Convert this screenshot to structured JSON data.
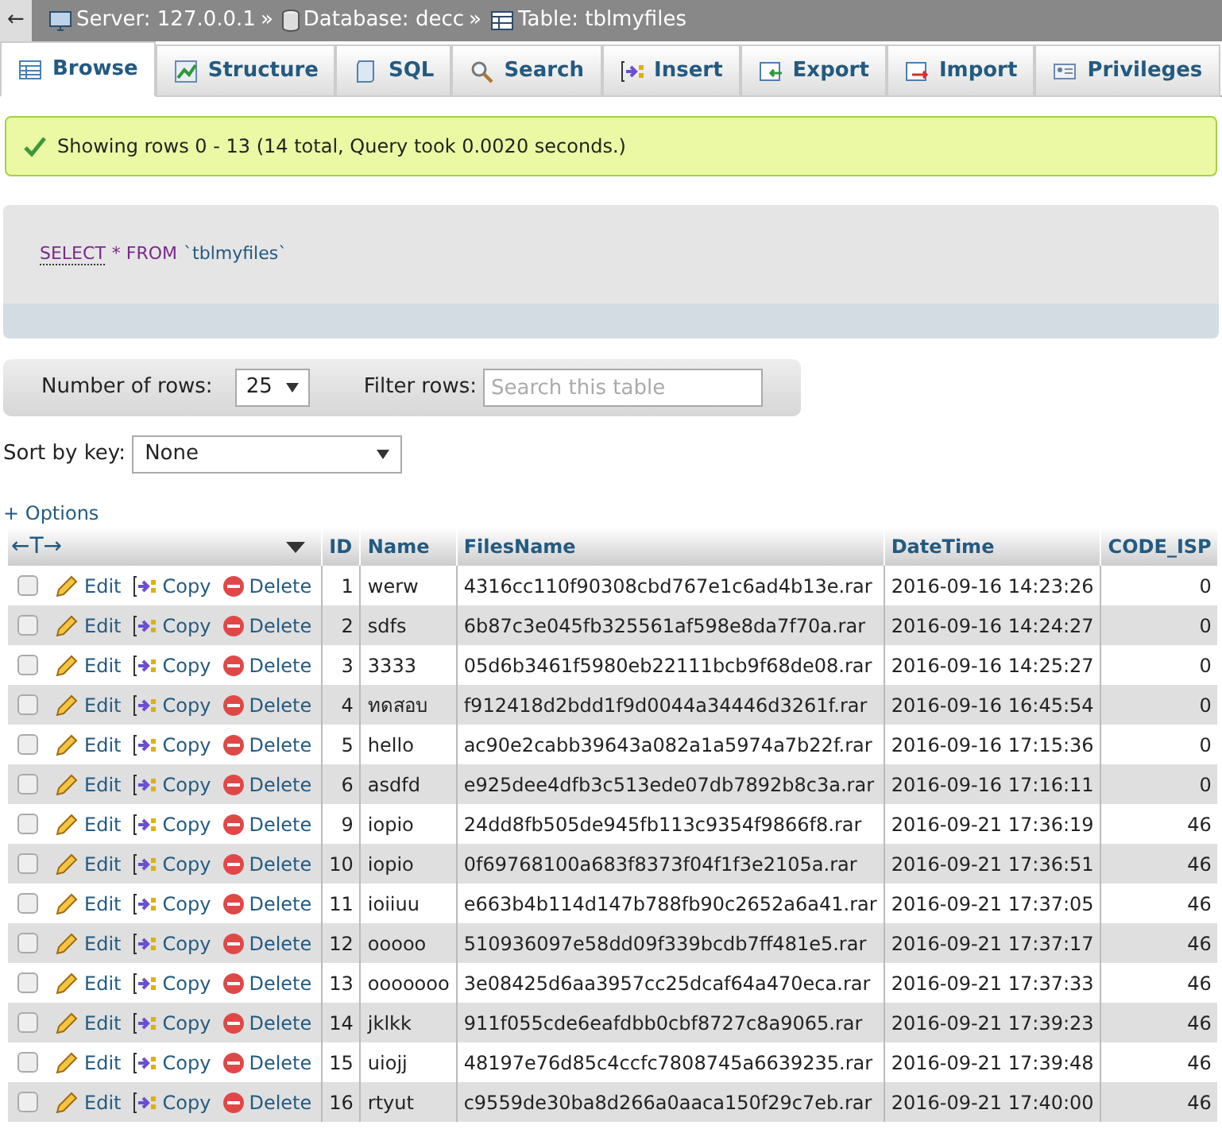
{
  "breadcrumb": {
    "back": "←",
    "items": [
      {
        "kind": "server",
        "text": "Server: 127.0.0.1"
      },
      {
        "kind": "database",
        "text": "Database: decc"
      },
      {
        "kind": "table",
        "text": "Table: tblmyfiles"
      }
    ],
    "separator": "»"
  },
  "tabs": [
    {
      "label": "Browse",
      "selected": true
    },
    {
      "label": "Structure",
      "selected": false
    },
    {
      "label": "SQL",
      "selected": false
    },
    {
      "label": "Search",
      "selected": false
    },
    {
      "label": "Insert",
      "selected": false
    },
    {
      "label": "Export",
      "selected": false
    },
    {
      "label": "Import",
      "selected": false
    },
    {
      "label": "Privileges",
      "selected": false
    }
  ],
  "message": "Showing rows 0 - 13 (14 total, Query took 0.0020 seconds.)",
  "query": {
    "keyword": "SELECT",
    "rest": "* FROM",
    "table": "`tblmyfiles`"
  },
  "navigation": {
    "rows_label": "Number of rows:",
    "rows_value": "25",
    "filter_label": "Filter rows:",
    "filter_placeholder": "Search this table"
  },
  "sort": {
    "label": "Sort by key:",
    "value": "None"
  },
  "options": "+ Options",
  "table": {
    "arrows": "←T→",
    "columns": [
      "ID",
      "Name",
      "FilesName",
      "DateTime",
      "CODE_ISP"
    ],
    "rows": [
      {
        "checked": false,
        "actions": [
          "Edit",
          "Copy",
          "Delete"
        ],
        "cells": [
          "1",
          "werw",
          "4316cc110f90308cbd767e1c6ad4b13e.rar",
          "2016-09-16 14:23:26",
          "0"
        ]
      },
      {
        "checked": false,
        "actions": [
          "Edit",
          "Copy",
          "Delete"
        ],
        "cells": [
          "2",
          "sdfs",
          "6b87c3e045fb325561af598e8da7f70a.rar",
          "2016-09-16 14:24:27",
          "0"
        ]
      },
      {
        "checked": false,
        "actions": [
          "Edit",
          "Copy",
          "Delete"
        ],
        "cells": [
          "3",
          "3333",
          "05d6b3461f5980eb22111bcb9f68de08.rar",
          "2016-09-16 14:25:27",
          "0"
        ]
      },
      {
        "checked": false,
        "actions": [
          "Edit",
          "Copy",
          "Delete"
        ],
        "cells": [
          "4",
          "ทดสอบ",
          "f912418d2bdd1f9d0044a34446d3261f.rar",
          "2016-09-16 16:45:54",
          "0"
        ]
      },
      {
        "checked": false,
        "actions": [
          "Edit",
          "Copy",
          "Delete"
        ],
        "cells": [
          "5",
          "hello",
          "ac90e2cabb39643a082a1a5974a7b22f.rar",
          "2016-09-16 17:15:36",
          "0"
        ]
      },
      {
        "checked": false,
        "actions": [
          "Edit",
          "Copy",
          "Delete"
        ],
        "cells": [
          "6",
          "asdfd",
          "e925dee4dfb3c513ede07db7892b8c3a.rar",
          "2016-09-16 17:16:11",
          "0"
        ]
      },
      {
        "checked": false,
        "actions": [
          "Edit",
          "Copy",
          "Delete"
        ],
        "cells": [
          "9",
          "iopio",
          "24dd8fb505de945fb113c9354f9866f8.rar",
          "2016-09-21 17:36:19",
          "46"
        ]
      },
      {
        "checked": false,
        "actions": [
          "Edit",
          "Copy",
          "Delete"
        ],
        "cells": [
          "10",
          "iopio",
          "0f69768100a683f8373f04f1f3e2105a.rar",
          "2016-09-21 17:36:51",
          "46"
        ]
      },
      {
        "checked": false,
        "actions": [
          "Edit",
          "Copy",
          "Delete"
        ],
        "cells": [
          "11",
          "ioiiuu",
          "e663b4b114d147b788fb90c2652a6a41.rar",
          "2016-09-21 17:37:05",
          "46"
        ]
      },
      {
        "checked": false,
        "actions": [
          "Edit",
          "Copy",
          "Delete"
        ],
        "cells": [
          "12",
          "ooooo",
          "510936097e58dd09f339bcdb7ff481e5.rar",
          "2016-09-21 17:37:17",
          "46"
        ]
      },
      {
        "checked": false,
        "actions": [
          "Edit",
          "Copy",
          "Delete"
        ],
        "cells": [
          "13",
          "ooooooo",
          "3e08425d6aa3957cc25dcaf64a470eca.rar",
          "2016-09-21 17:37:33",
          "46"
        ]
      },
      {
        "checked": false,
        "actions": [
          "Edit",
          "Copy",
          "Delete"
        ],
        "cells": [
          "14",
          "jklkk",
          "911f055cde6eafdbb0cbf8727c8a9065.rar",
          "2016-09-21 17:39:23",
          "46"
        ]
      },
      {
        "checked": false,
        "actions": [
          "Edit",
          "Copy",
          "Delete"
        ],
        "cells": [
          "15",
          "uiojj",
          "48197e76d85c4ccfc7808745a6639235.rar",
          "2016-09-21 17:39:48",
          "46"
        ]
      },
      {
        "checked": false,
        "actions": [
          "Edit",
          "Copy",
          "Delete"
        ],
        "cells": [
          "16",
          "rtyut",
          "c9559de30ba8d266a0aaca150f29c7eb.rar",
          "2016-09-21 17:40:00",
          "46"
        ]
      }
    ]
  }
}
